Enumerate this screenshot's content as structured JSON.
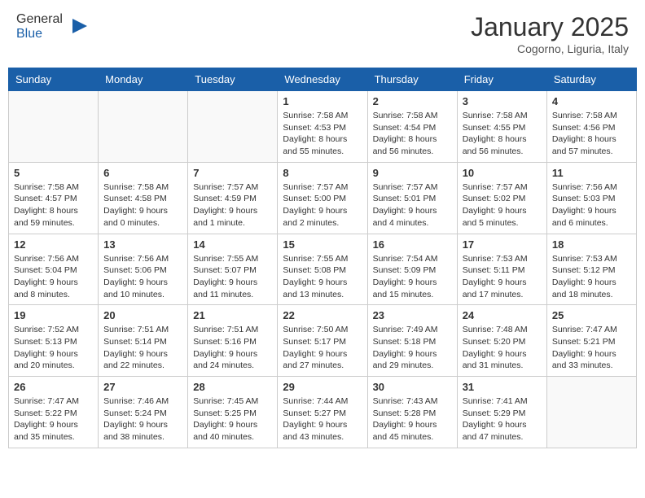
{
  "header": {
    "logo_general": "General",
    "logo_blue": "Blue",
    "month_title": "January 2025",
    "location": "Cogorno, Liguria, Italy"
  },
  "calendar": {
    "days_of_week": [
      "Sunday",
      "Monday",
      "Tuesday",
      "Wednesday",
      "Thursday",
      "Friday",
      "Saturday"
    ],
    "weeks": [
      [
        {
          "day": "",
          "info": ""
        },
        {
          "day": "",
          "info": ""
        },
        {
          "day": "",
          "info": ""
        },
        {
          "day": "1",
          "info": "Sunrise: 7:58 AM\nSunset: 4:53 PM\nDaylight: 8 hours\nand 55 minutes."
        },
        {
          "day": "2",
          "info": "Sunrise: 7:58 AM\nSunset: 4:54 PM\nDaylight: 8 hours\nand 56 minutes."
        },
        {
          "day": "3",
          "info": "Sunrise: 7:58 AM\nSunset: 4:55 PM\nDaylight: 8 hours\nand 56 minutes."
        },
        {
          "day": "4",
          "info": "Sunrise: 7:58 AM\nSunset: 4:56 PM\nDaylight: 8 hours\nand 57 minutes."
        }
      ],
      [
        {
          "day": "5",
          "info": "Sunrise: 7:58 AM\nSunset: 4:57 PM\nDaylight: 8 hours\nand 59 minutes."
        },
        {
          "day": "6",
          "info": "Sunrise: 7:58 AM\nSunset: 4:58 PM\nDaylight: 9 hours\nand 0 minutes."
        },
        {
          "day": "7",
          "info": "Sunrise: 7:57 AM\nSunset: 4:59 PM\nDaylight: 9 hours\nand 1 minute."
        },
        {
          "day": "8",
          "info": "Sunrise: 7:57 AM\nSunset: 5:00 PM\nDaylight: 9 hours\nand 2 minutes."
        },
        {
          "day": "9",
          "info": "Sunrise: 7:57 AM\nSunset: 5:01 PM\nDaylight: 9 hours\nand 4 minutes."
        },
        {
          "day": "10",
          "info": "Sunrise: 7:57 AM\nSunset: 5:02 PM\nDaylight: 9 hours\nand 5 minutes."
        },
        {
          "day": "11",
          "info": "Sunrise: 7:56 AM\nSunset: 5:03 PM\nDaylight: 9 hours\nand 6 minutes."
        }
      ],
      [
        {
          "day": "12",
          "info": "Sunrise: 7:56 AM\nSunset: 5:04 PM\nDaylight: 9 hours\nand 8 minutes."
        },
        {
          "day": "13",
          "info": "Sunrise: 7:56 AM\nSunset: 5:06 PM\nDaylight: 9 hours\nand 10 minutes."
        },
        {
          "day": "14",
          "info": "Sunrise: 7:55 AM\nSunset: 5:07 PM\nDaylight: 9 hours\nand 11 minutes."
        },
        {
          "day": "15",
          "info": "Sunrise: 7:55 AM\nSunset: 5:08 PM\nDaylight: 9 hours\nand 13 minutes."
        },
        {
          "day": "16",
          "info": "Sunrise: 7:54 AM\nSunset: 5:09 PM\nDaylight: 9 hours\nand 15 minutes."
        },
        {
          "day": "17",
          "info": "Sunrise: 7:53 AM\nSunset: 5:11 PM\nDaylight: 9 hours\nand 17 minutes."
        },
        {
          "day": "18",
          "info": "Sunrise: 7:53 AM\nSunset: 5:12 PM\nDaylight: 9 hours\nand 18 minutes."
        }
      ],
      [
        {
          "day": "19",
          "info": "Sunrise: 7:52 AM\nSunset: 5:13 PM\nDaylight: 9 hours\nand 20 minutes."
        },
        {
          "day": "20",
          "info": "Sunrise: 7:51 AM\nSunset: 5:14 PM\nDaylight: 9 hours\nand 22 minutes."
        },
        {
          "day": "21",
          "info": "Sunrise: 7:51 AM\nSunset: 5:16 PM\nDaylight: 9 hours\nand 24 minutes."
        },
        {
          "day": "22",
          "info": "Sunrise: 7:50 AM\nSunset: 5:17 PM\nDaylight: 9 hours\nand 27 minutes."
        },
        {
          "day": "23",
          "info": "Sunrise: 7:49 AM\nSunset: 5:18 PM\nDaylight: 9 hours\nand 29 minutes."
        },
        {
          "day": "24",
          "info": "Sunrise: 7:48 AM\nSunset: 5:20 PM\nDaylight: 9 hours\nand 31 minutes."
        },
        {
          "day": "25",
          "info": "Sunrise: 7:47 AM\nSunset: 5:21 PM\nDaylight: 9 hours\nand 33 minutes."
        }
      ],
      [
        {
          "day": "26",
          "info": "Sunrise: 7:47 AM\nSunset: 5:22 PM\nDaylight: 9 hours\nand 35 minutes."
        },
        {
          "day": "27",
          "info": "Sunrise: 7:46 AM\nSunset: 5:24 PM\nDaylight: 9 hours\nand 38 minutes."
        },
        {
          "day": "28",
          "info": "Sunrise: 7:45 AM\nSunset: 5:25 PM\nDaylight: 9 hours\nand 40 minutes."
        },
        {
          "day": "29",
          "info": "Sunrise: 7:44 AM\nSunset: 5:27 PM\nDaylight: 9 hours\nand 43 minutes."
        },
        {
          "day": "30",
          "info": "Sunrise: 7:43 AM\nSunset: 5:28 PM\nDaylight: 9 hours\nand 45 minutes."
        },
        {
          "day": "31",
          "info": "Sunrise: 7:41 AM\nSunset: 5:29 PM\nDaylight: 9 hours\nand 47 minutes."
        },
        {
          "day": "",
          "info": ""
        }
      ]
    ]
  }
}
